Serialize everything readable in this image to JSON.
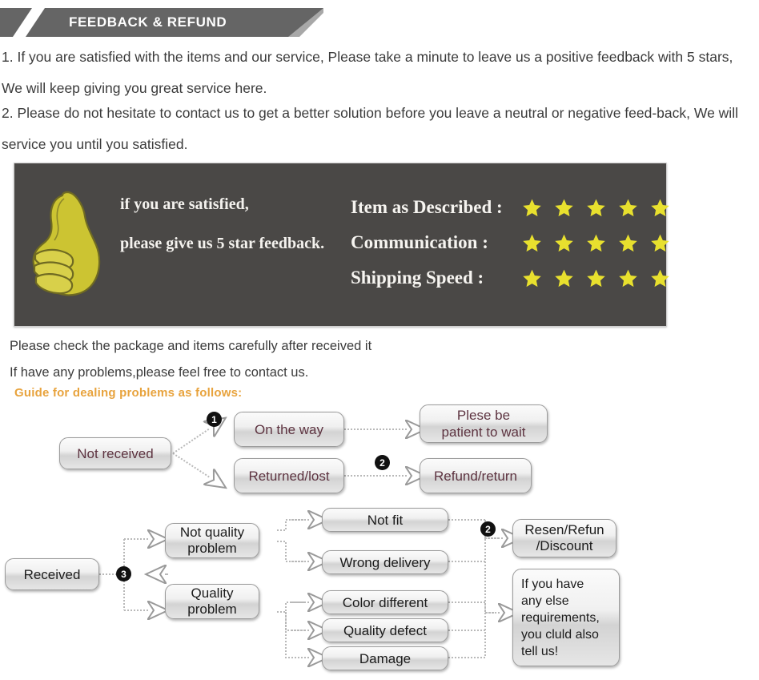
{
  "banner": {
    "title": "FEEDBACK & REFUND"
  },
  "intro": {
    "paragraph1": "1. If you are satisfied with the items and our service, Please take a minute to leave us a positive feedback with 5 stars, We will keep giving you great service here.",
    "paragraph2": "2. Please do not hesitate to contact us to get a better solution before you leave a neutral or negative feed-back, We will service you until you satisfied."
  },
  "panel": {
    "thumb_icon": "thumbs-up-icon",
    "line1": "if you are satisfied,",
    "line2": "please give us 5 star feedback.",
    "star_color": "#e8e02e",
    "background_color": "#4a4846",
    "ratings": [
      {
        "label": "Item as Described :",
        "stars": 5
      },
      {
        "label": "Communication :",
        "stars": 5
      },
      {
        "label": "Shipping Speed :",
        "stars": 5
      }
    ]
  },
  "notes": {
    "note1": "Please check the package and items carefully after received it",
    "note2": "If have any problems,please feel free to contact us.",
    "guide": "Guide for dealing problems as follows:",
    "guide_color": "#e8a33d"
  },
  "flow_top": {
    "start": "Not received",
    "badge1": "1",
    "badge2": "2",
    "branch_a": "On the way",
    "branch_b": "Returned/lost",
    "result_a": "Plese be\npatient to wait",
    "result_a_line1": "Plese be",
    "result_a_line2": "patient to wait",
    "result_b": "Refund/return"
  },
  "flow_bottom": {
    "start": "Received",
    "badge3": "3",
    "badge2": "2",
    "branch_a_line1": "Not quality",
    "branch_a_line2": "problem",
    "branch_b_line1": "Quality",
    "branch_b_line2": "problem",
    "reasons": [
      "Not fit",
      "Wrong delivery",
      "Color different",
      "Quality defect",
      "Damage"
    ],
    "result_a_line1": "Resen/Refun",
    "result_a_line2": "/Discount",
    "result_b_lines": [
      "If you have",
      "any else",
      "requirements,",
      "you cluld also",
      "tell us!"
    ]
  }
}
